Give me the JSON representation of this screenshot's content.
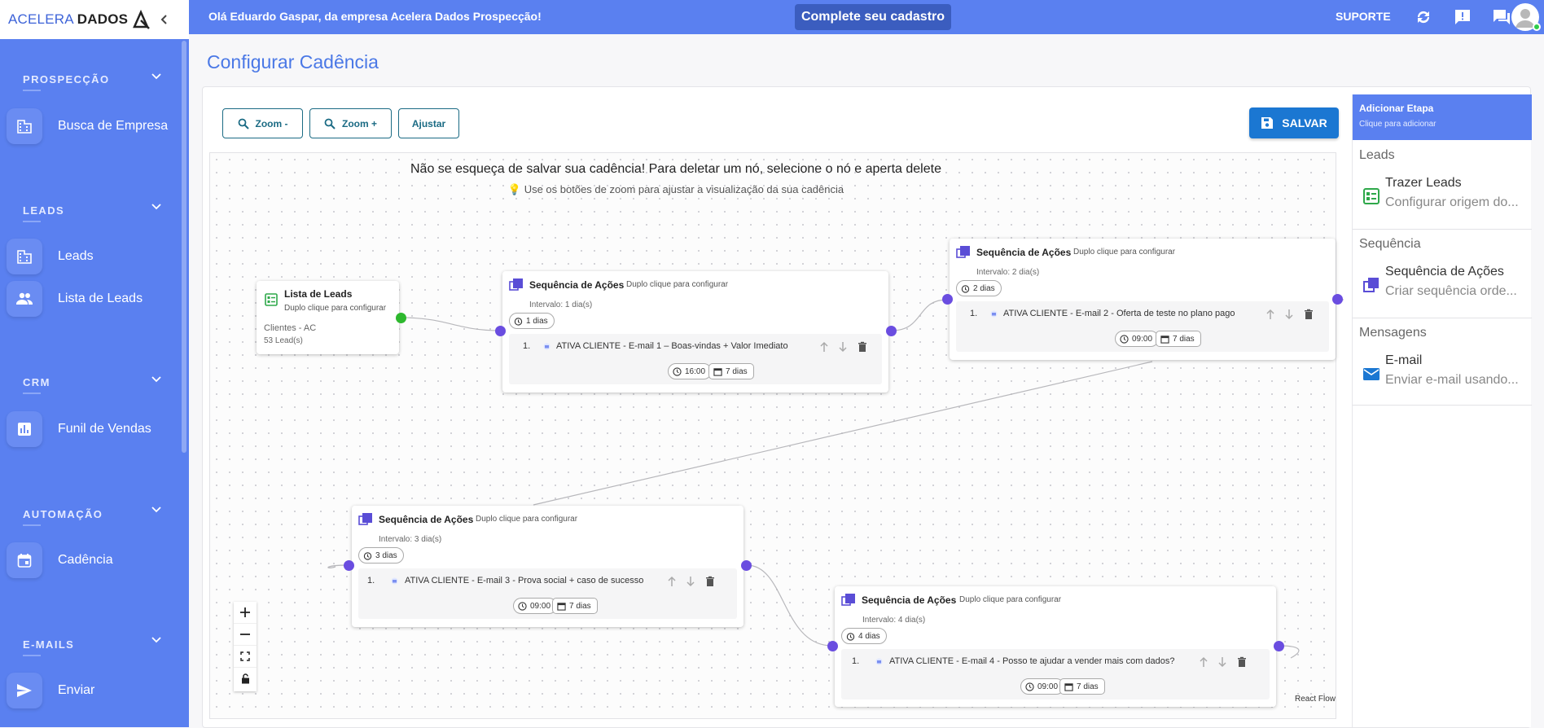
{
  "brand": {
    "name_part1": "ACELERA",
    "name_part2": "DADOS"
  },
  "sidebar": {
    "sections": [
      {
        "title": "PROSPECÇÃO",
        "items": [
          {
            "label": "Busca de Empresa",
            "icon": "building-icon"
          }
        ]
      },
      {
        "title": "LEADS",
        "items": [
          {
            "label": "Leads",
            "icon": "building-icon"
          },
          {
            "label": "Lista de Leads",
            "icon": "people-icon"
          }
        ]
      },
      {
        "title": "CRM",
        "items": [
          {
            "label": "Funil de Vendas",
            "icon": "chart-icon"
          }
        ]
      },
      {
        "title": "AUTOMAÇÃO",
        "items": [
          {
            "label": "Cadência",
            "icon": "calendar-icon"
          }
        ]
      },
      {
        "title": "E-MAILS",
        "items": [
          {
            "label": "Enviar",
            "icon": "send-icon"
          }
        ]
      }
    ]
  },
  "topbar": {
    "greeting": "Olá Eduardo Gaspar, da empresa Acelera Dados Prospecção!",
    "complete_button": "Complete seu cadastro",
    "support": "SUPORTE"
  },
  "page": {
    "title": "Configurar Cadência",
    "toolbar": {
      "zoom_out": "Zoom -",
      "zoom_in": "Zoom +",
      "fit": "Ajustar",
      "save": "SALVAR"
    },
    "hint_main": "Não se esqueça de salvar sua cadência! Para deletar um nó, selecione o nó e aperta delete",
    "hint_sub": "Use os botões de zoom para ajustar a visualização da sua cadência",
    "attribution": "React Flow"
  },
  "flow": {
    "lead_node": {
      "title": "Lista de Leads",
      "subtitle": "Duplo clique para configurar",
      "list_name": "Clientes - AC",
      "count": "53 Lead(s)"
    },
    "sequences": [
      {
        "title": "Sequência de Ações",
        "subtitle": "Duplo clique para configurar",
        "interval": "Intervalo: 1 dia(s)",
        "days_chip": "1 dias",
        "actions": [
          {
            "num": "1.",
            "text": "ATIVA CLIENTE - E-mail 1 – Boas-vindas + Valor Imediato",
            "time": "16:00",
            "days": "7 dias"
          }
        ]
      },
      {
        "title": "Sequência de Ações",
        "subtitle": "Duplo clique para configurar",
        "interval": "Intervalo: 2 dia(s)",
        "days_chip": "2 dias",
        "actions": [
          {
            "num": "1.",
            "text": "ATIVA CLIENTE - E-mail 2 - Oferta de teste no plano pago",
            "time": "09:00",
            "days": "7 dias"
          }
        ]
      },
      {
        "title": "Sequência de Ações",
        "subtitle": "Duplo clique para configurar",
        "interval": "Intervalo: 3 dia(s)",
        "days_chip": "3 dias",
        "actions": [
          {
            "num": "1.",
            "text": "ATIVA CLIENTE - E-mail 3 - Prova social + caso de sucesso",
            "time": "09:00",
            "days": "7 dias"
          }
        ]
      },
      {
        "title": "Sequência de Ações",
        "subtitle": "Duplo clique para configurar",
        "interval": "Intervalo: 4 dia(s)",
        "days_chip": "4 dias",
        "actions": [
          {
            "num": "1.",
            "text": "ATIVA CLIENTE - E-mail 4 - Posso te ajudar a vender mais com dados?",
            "time": "09:00",
            "days": "7 dias"
          }
        ]
      }
    ]
  },
  "panel": {
    "header_title": "Adicionar Etapa",
    "header_sub": "Clique para adicionar",
    "sections": [
      {
        "title": "Leads",
        "item_title": "Trazer Leads",
        "item_desc": "Configurar origem do...",
        "icon": "lead-list-icon"
      },
      {
        "title": "Sequência",
        "item_title": "Sequência de Ações",
        "item_desc": "Criar sequência orde...",
        "icon": "stack-icon"
      },
      {
        "title": "Mensagens",
        "item_title": "E-mail",
        "item_desc": "Enviar e-mail usando...",
        "icon": "mail-icon"
      }
    ]
  },
  "colors": {
    "primary": "#5a80f0",
    "save": "#1b77d2",
    "handle": "#6a4de0",
    "start_handle": "#2eb82e"
  }
}
